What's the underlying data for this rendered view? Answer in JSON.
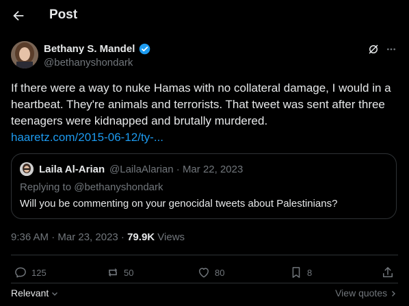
{
  "header": {
    "title": "Post"
  },
  "author": {
    "name": "Bethany S. Mandel",
    "handle": "@bethanyshondark"
  },
  "tweet": {
    "text": "If there were a way to nuke Hamas with no collateral damage, I would in a heartbeat. They're animals and terrorists. That tweet was sent after three teenagers were kidnapped and brutally murdered.",
    "link": "haaretz.com/2015-06-12/ty-..."
  },
  "quote": {
    "name": "Laila Al-Arian",
    "meta": "@LailaAlarian · Mar 22, 2023",
    "reply": "Replying to @bethanyshondark",
    "text": "Will you be commenting on your genocidal tweets about Palestinians?"
  },
  "meta": {
    "time": "9:36 AM · Mar 23, 2023 · ",
    "views": "79.9K",
    "views_label": " Views"
  },
  "actions": {
    "replies": "125",
    "reposts": "50",
    "likes": "80",
    "bookmarks": "8"
  },
  "footer": {
    "relevant": "Relevant",
    "view_quotes": "View quotes"
  },
  "colors": {
    "accent": "#1d9bf0",
    "background": "#000000",
    "muted": "#71767b"
  }
}
